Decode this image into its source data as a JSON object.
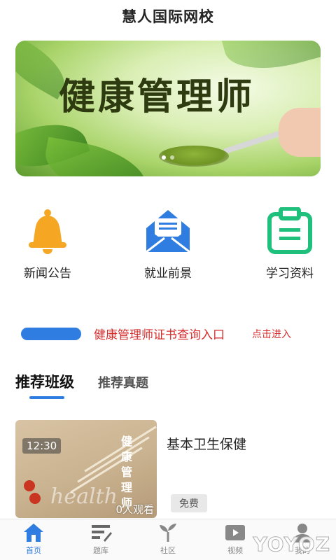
{
  "app": {
    "title": "慧人国际网校"
  },
  "banner": {
    "text": "健康管理师",
    "slides": 2,
    "active_slide": 0
  },
  "features": [
    {
      "label": "新闻公告",
      "icon": "bell-icon",
      "color": "#f5a623"
    },
    {
      "label": "就业前景",
      "icon": "envelope-icon",
      "color": "#2f7de0"
    },
    {
      "label": "学习资料",
      "icon": "clipboard-icon",
      "color": "#1fbf7c"
    }
  ],
  "cert": {
    "link_text": "健康管理师证书查询入口",
    "enter_text": "点击进入",
    "color": "#d62b2b"
  },
  "tabs": [
    {
      "label": "推荐班级",
      "active": true
    },
    {
      "label": "推荐真题",
      "active": false
    }
  ],
  "course": {
    "title": "基本卫生保健",
    "duration": "12:30",
    "views": "0人观看",
    "badge": "免费",
    "thumb_vertical_text": "健康管理师",
    "thumb_word": "health"
  },
  "bottom_nav": [
    {
      "label": "首页",
      "icon": "home-icon",
      "active": true
    },
    {
      "label": "题库",
      "icon": "question-bank-icon",
      "active": false
    },
    {
      "label": "社区",
      "icon": "sprout-icon",
      "active": false
    },
    {
      "label": "视频",
      "icon": "video-icon",
      "active": false
    },
    {
      "label": "我的",
      "icon": "user-icon",
      "active": false
    }
  ],
  "watermark": "YOYOZ",
  "accent_color": "#2f7de0"
}
